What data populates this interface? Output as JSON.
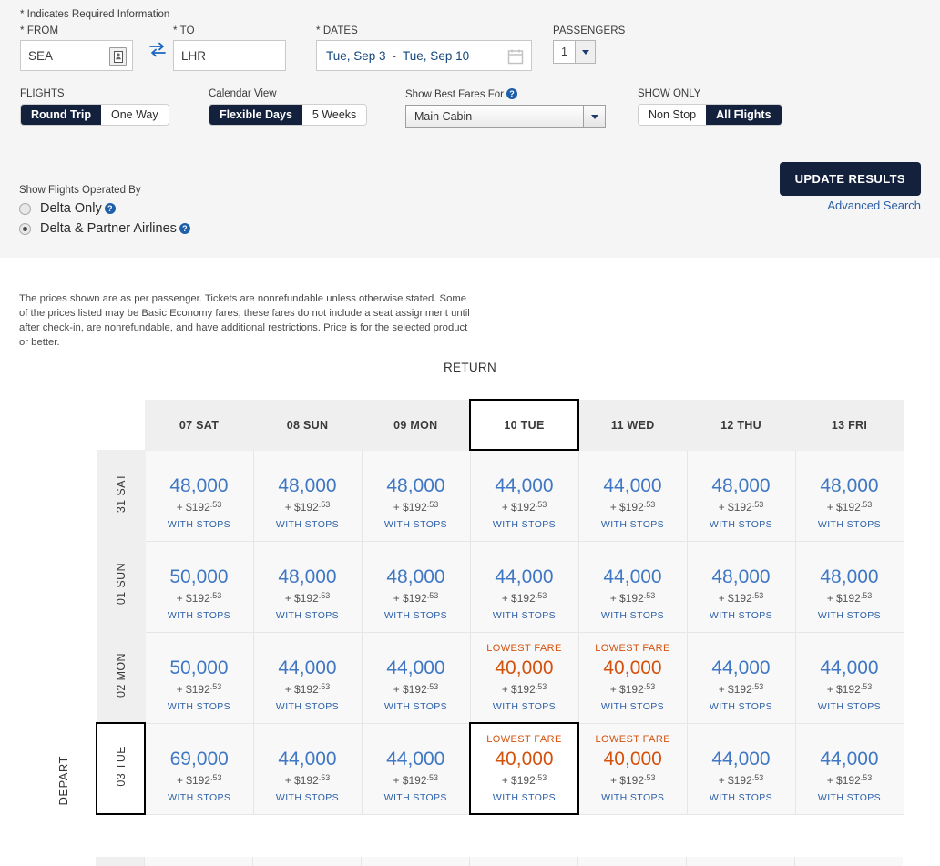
{
  "search": {
    "required_note": "* Indicates Required Information",
    "from": {
      "label": "* FROM",
      "value": "SEA",
      "icon": "airport-list-icon"
    },
    "swap": {
      "icon": "swap-arrows-icon"
    },
    "to": {
      "label": "* TO",
      "value": "LHR"
    },
    "dates": {
      "label": "* DATES",
      "depart": "Tue, Sep 3",
      "separator": "-",
      "return": "Tue, Sep 10",
      "icon": "calendar-icon"
    },
    "passengers": {
      "label": "PASSENGERS",
      "value": "1"
    },
    "flights": {
      "label": "FLIGHTS",
      "options": [
        "Round Trip",
        "One Way"
      ],
      "selected": "Round Trip"
    },
    "calendar_view": {
      "label": "Calendar View",
      "options": [
        "Flexible Days",
        "5 Weeks"
      ],
      "selected": "Flexible Days"
    },
    "best_fares": {
      "label": "Show Best Fares For",
      "selected": "Main Cabin",
      "help_icon": "help-icon"
    },
    "show_only": {
      "label": "SHOW ONLY",
      "options": [
        "Non Stop",
        "All Flights"
      ],
      "selected": "All Flights"
    },
    "operated_by": {
      "title": "Show Flights Operated By",
      "options": [
        {
          "label": "Delta Only",
          "checked": false
        },
        {
          "label": "Delta & Partner Airlines",
          "checked": true
        }
      ]
    },
    "update_button": "UPDATE RESULTS",
    "advanced_search": "Advanced Search"
  },
  "disclaimer": "The prices shown are as per passenger. Tickets are nonrefundable unless otherwise stated. Some of the prices listed may be Basic Economy fares; these fares do not include a seat assignment until after check-in, are nonrefundable, and have additional restrictions. Price is for the selected product or better.",
  "calendar": {
    "return_label": "RETURN",
    "depart_label": "DEPART",
    "lowest_fare_label": "LOWEST FARE",
    "stops_label": "WITH STOPS",
    "cash_prefix": "+ $",
    "cash_dollars": "192",
    "cash_cents": ".53",
    "colors": {
      "miles": "#3f77c4",
      "lowest": "#d4510c",
      "stops": "#2b5fa8",
      "header_bg": "#efefef",
      "cell_bg": "#f8f8f8"
    },
    "columns": [
      {
        "label": "07 SAT",
        "selected": false
      },
      {
        "label": "08 SUN",
        "selected": false
      },
      {
        "label": "09 MON",
        "selected": false
      },
      {
        "label": "10 TUE",
        "selected": true
      },
      {
        "label": "11 WED",
        "selected": false
      },
      {
        "label": "12 THU",
        "selected": false
      },
      {
        "label": "13 FRI",
        "selected": false
      }
    ],
    "rows": [
      {
        "label": "31 SAT",
        "selected": false,
        "cells": [
          {
            "miles": "48,000",
            "cash": "192",
            "cents": ".53",
            "lowest": false,
            "selected": false
          },
          {
            "miles": "48,000",
            "cash": "192",
            "cents": ".53",
            "lowest": false,
            "selected": false
          },
          {
            "miles": "48,000",
            "cash": "192",
            "cents": ".53",
            "lowest": false,
            "selected": false
          },
          {
            "miles": "44,000",
            "cash": "192",
            "cents": ".53",
            "lowest": false,
            "selected": false
          },
          {
            "miles": "44,000",
            "cash": "192",
            "cents": ".53",
            "lowest": false,
            "selected": false
          },
          {
            "miles": "48,000",
            "cash": "192",
            "cents": ".53",
            "lowest": false,
            "selected": false
          },
          {
            "miles": "48,000",
            "cash": "192",
            "cents": ".53",
            "lowest": false,
            "selected": false
          }
        ]
      },
      {
        "label": "01 SUN",
        "selected": false,
        "cells": [
          {
            "miles": "50,000",
            "cash": "192",
            "cents": ".53",
            "lowest": false,
            "selected": false
          },
          {
            "miles": "48,000",
            "cash": "192",
            "cents": ".53",
            "lowest": false,
            "selected": false
          },
          {
            "miles": "48,000",
            "cash": "192",
            "cents": ".53",
            "lowest": false,
            "selected": false
          },
          {
            "miles": "44,000",
            "cash": "192",
            "cents": ".53",
            "lowest": false,
            "selected": false
          },
          {
            "miles": "44,000",
            "cash": "192",
            "cents": ".53",
            "lowest": false,
            "selected": false
          },
          {
            "miles": "48,000",
            "cash": "192",
            "cents": ".53",
            "lowest": false,
            "selected": false
          },
          {
            "miles": "48,000",
            "cash": "192",
            "cents": ".53",
            "lowest": false,
            "selected": false
          }
        ]
      },
      {
        "label": "02 MON",
        "selected": false,
        "cells": [
          {
            "miles": "50,000",
            "cash": "192",
            "cents": ".53",
            "lowest": false,
            "selected": false
          },
          {
            "miles": "44,000",
            "cash": "192",
            "cents": ".53",
            "lowest": false,
            "selected": false
          },
          {
            "miles": "44,000",
            "cash": "192",
            "cents": ".53",
            "lowest": false,
            "selected": false
          },
          {
            "miles": "40,000",
            "cash": "192",
            "cents": ".53",
            "lowest": true,
            "selected": false
          },
          {
            "miles": "40,000",
            "cash": "192",
            "cents": ".53",
            "lowest": true,
            "selected": false
          },
          {
            "miles": "44,000",
            "cash": "192",
            "cents": ".53",
            "lowest": false,
            "selected": false
          },
          {
            "miles": "44,000",
            "cash": "192",
            "cents": ".53",
            "lowest": false,
            "selected": false
          }
        ]
      },
      {
        "label": "03 TUE",
        "selected": true,
        "cells": [
          {
            "miles": "69,000",
            "cash": "192",
            "cents": ".53",
            "lowest": false,
            "selected": false
          },
          {
            "miles": "44,000",
            "cash": "192",
            "cents": ".53",
            "lowest": false,
            "selected": false
          },
          {
            "miles": "44,000",
            "cash": "192",
            "cents": ".53",
            "lowest": false,
            "selected": false
          },
          {
            "miles": "40,000",
            "cash": "192",
            "cents": ".53",
            "lowest": true,
            "selected": true
          },
          {
            "miles": "40,000",
            "cash": "192",
            "cents": ".53",
            "lowest": true,
            "selected": false
          },
          {
            "miles": "44,000",
            "cash": "192",
            "cents": ".53",
            "lowest": false,
            "selected": false
          },
          {
            "miles": "44,000",
            "cash": "192",
            "cents": ".53",
            "lowest": false,
            "selected": false
          }
        ]
      }
    ]
  }
}
